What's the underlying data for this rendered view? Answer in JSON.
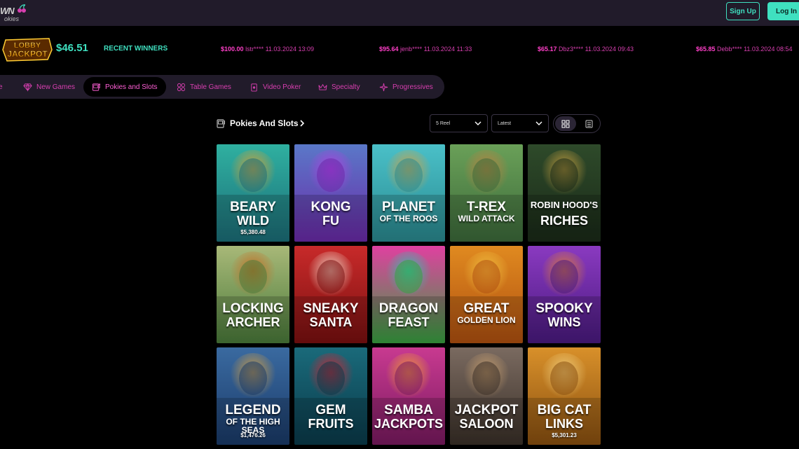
{
  "brand": {
    "logo_text": "WN",
    "logo_sub": "okies"
  },
  "header": {
    "signup_label": "Sign Up",
    "login_label": "Log In"
  },
  "jackpot": {
    "badge_line1": "LOBBY",
    "badge_line2": "JACKPOT",
    "amount": "$46.51"
  },
  "recent_winners": {
    "label": "RECENT WINNERS",
    "items": [
      {
        "amount": "$100.00",
        "rest": "lstr**** 11.03.2024 13:09"
      },
      {
        "amount": "$95.64",
        "rest": "jenb**** 11.03.2024 11:33"
      },
      {
        "amount": "$65.17",
        "rest": "Dbz3**** 11.03.2024 09:43"
      },
      {
        "amount": "$65.85",
        "rest": "Debb**** 11.03.2024 08:54"
      }
    ]
  },
  "categories": [
    {
      "label": "e",
      "icon": "home-icon"
    },
    {
      "label": "New Games",
      "icon": "diamond-icon"
    },
    {
      "label": "Pokies and Slots",
      "icon": "slot-machine-icon",
      "active": true
    },
    {
      "label": "Table Games",
      "icon": "chips-icon"
    },
    {
      "label": "Video Poker",
      "icon": "cards-icon"
    },
    {
      "label": "Specialty",
      "icon": "crown-icon"
    },
    {
      "label": "Progressives",
      "icon": "sparkle-icon"
    }
  ],
  "section": {
    "title": "Pokies And Slots"
  },
  "filters": {
    "reels": "5 Reel",
    "sort": "Latest"
  },
  "colors": {
    "accent_teal": "#3fe0c0",
    "accent_pink": "#ff3fc8",
    "nav_bg": "#211b2a"
  },
  "games": [
    {
      "line1": "BEARY",
      "line2": "WILD",
      "jackpot": "$5,380.48"
    },
    {
      "line1": "KONG",
      "line2": "FU",
      "jackpot": ""
    },
    {
      "line1": "PLANET",
      "line2": "OF THE ROOS",
      "jackpot": ""
    },
    {
      "line1": "T-REX",
      "line2": "WILD ATTACK",
      "jackpot": ""
    },
    {
      "line1": "ROBIN HOOD'S",
      "line2": "RICHES",
      "jackpot": ""
    },
    {
      "line1": "LOCKING",
      "line2": "ARCHER",
      "jackpot": ""
    },
    {
      "line1": "SNEAKY",
      "line2": "SANTA",
      "jackpot": ""
    },
    {
      "line1": "DRAGON",
      "line2": "FEAST",
      "jackpot": ""
    },
    {
      "line1": "GREAT",
      "line2": "GOLDEN LION",
      "jackpot": ""
    },
    {
      "line1": "SPOOKY",
      "line2": "WINS",
      "jackpot": ""
    },
    {
      "line1": "LEGEND",
      "line2": "OF THE HIGH SEAS",
      "jackpot": "$1,476.26"
    },
    {
      "line1": "GEM",
      "line2": "FRUITS",
      "jackpot": ""
    },
    {
      "line1": "SAMBA",
      "line2": "JACKPOTS",
      "jackpot": ""
    },
    {
      "line1": "JACKPOT",
      "line2": "SALOON",
      "jackpot": ""
    },
    {
      "line1": "BIG CAT",
      "line2": "LINKS",
      "jackpot": "$5,301.23"
    }
  ]
}
